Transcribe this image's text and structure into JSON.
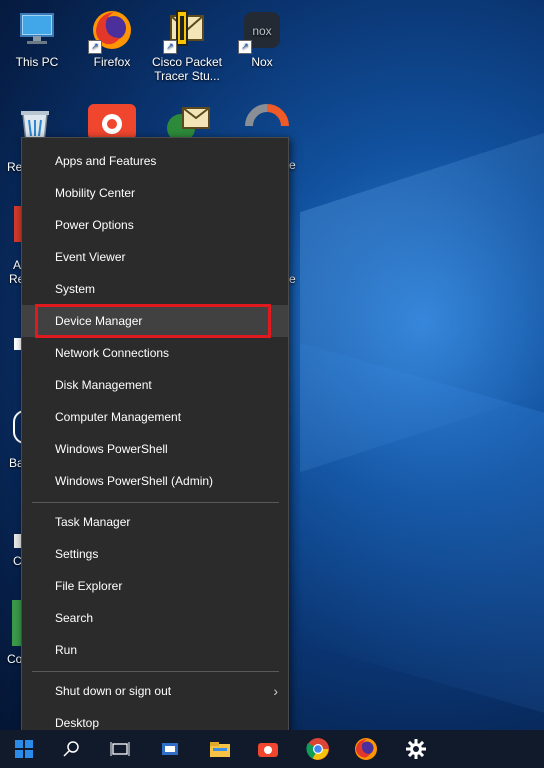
{
  "desktop": {
    "icons": [
      {
        "label": "This PC",
        "icon": "monitor-icon"
      },
      {
        "label": "Firefox",
        "icon": "firefox-icon"
      },
      {
        "label": "Cisco Packet Tracer Stu...",
        "icon": "cisco-packet-tracer-icon"
      },
      {
        "label": "Nox",
        "icon": "nox-icon"
      }
    ],
    "partial_labels": [
      "Re",
      "A",
      "Re",
      "Ba",
      "C",
      "Co",
      "e",
      "e"
    ]
  },
  "menu": {
    "group1": [
      "Apps and Features",
      "Mobility Center",
      "Power Options",
      "Event Viewer",
      "System",
      "Device Manager",
      "Network Connections",
      "Disk Management",
      "Computer Management",
      "Windows PowerShell",
      "Windows PowerShell (Admin)"
    ],
    "group2": [
      "Task Manager",
      "Settings",
      "File Explorer",
      "Search",
      "Run"
    ],
    "group3": [
      "Shut down or sign out",
      "Desktop"
    ],
    "highlighted": "Device Manager",
    "submenu_chevron": "›"
  },
  "taskbar": {
    "items": [
      "start-icon",
      "search-icon",
      "task-view-icon",
      "app-icon",
      "explorer-icon",
      "camera-app-icon",
      "chrome-icon",
      "firefox-icon",
      "settings-gear-icon"
    ]
  },
  "colors": {
    "menu_bg": "#2b2b2b",
    "hover_bg": "#414141",
    "highlight_border": "#e0191f",
    "taskbar_bg": "#101a2b"
  }
}
